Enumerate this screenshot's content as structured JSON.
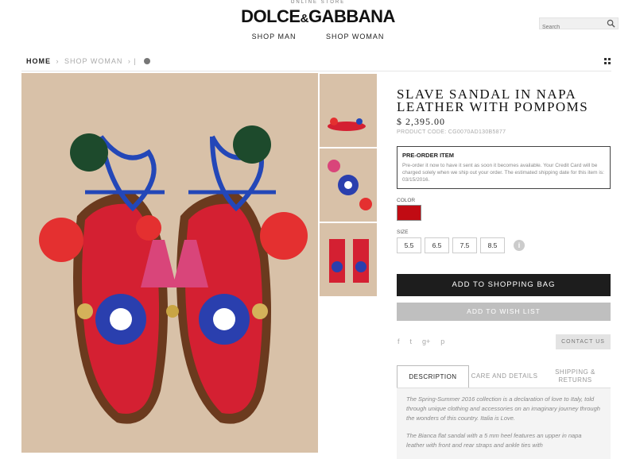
{
  "header": {
    "top_label": "ONLINE STORE",
    "brand_left": "DOLCE",
    "brand_amp": "&",
    "brand_right": "GABBANA",
    "nav": [
      "SHOP MAN",
      "SHOP WOMAN"
    ],
    "search_placeholder": "Search"
  },
  "breadcrumb": {
    "home": "HOME",
    "sep": "›",
    "current": "SHOP WOMAN",
    "trail": "› |"
  },
  "product": {
    "title": "SLAVE SANDAL IN NAPA LEATHER WITH POMPOMS",
    "price": "$ 2,395.00",
    "code": "PRODUCT CODE: CG0070AD130B5877",
    "preorder": {
      "heading": "PRE-ORDER ITEM",
      "body": "Pre-order it now to have it sent as soon it becomes available. Your Credit Card will be charged solely when we ship out your order. The estimated shipping date for this item is: 03/15/2016."
    },
    "color_label": "COLOR",
    "color_value": "#c10b13",
    "size_label": "SIZE",
    "sizes": [
      "5.5",
      "6.5",
      "7.5",
      "8.5"
    ],
    "size_info": "i",
    "add_to_bag": "ADD TO SHOPPING BAG",
    "add_to_wishlist": "ADD TO WISH LIST",
    "social": [
      "f",
      "t",
      "g+",
      "p"
    ],
    "contact": "CONTACT US"
  },
  "tabs": [
    "DESCRIPTION",
    "CARE AND DETAILS",
    "SHIPPING & RETURNS"
  ],
  "description": [
    "The Spring-Summer 2016 collection is a declaration of love to Italy, told through unique clothing and accessories on an imaginary journey through the wonders of this country. Italia is Love.",
    "The Bianca flat sandal with a 5 mm heel features an upper in napa leather with front and rear straps and ankle ties with"
  ],
  "colors": {
    "accent_dark": "#1d1d1d",
    "wish_gray": "#bfbfbf",
    "swatch_red": "#c10b13"
  }
}
